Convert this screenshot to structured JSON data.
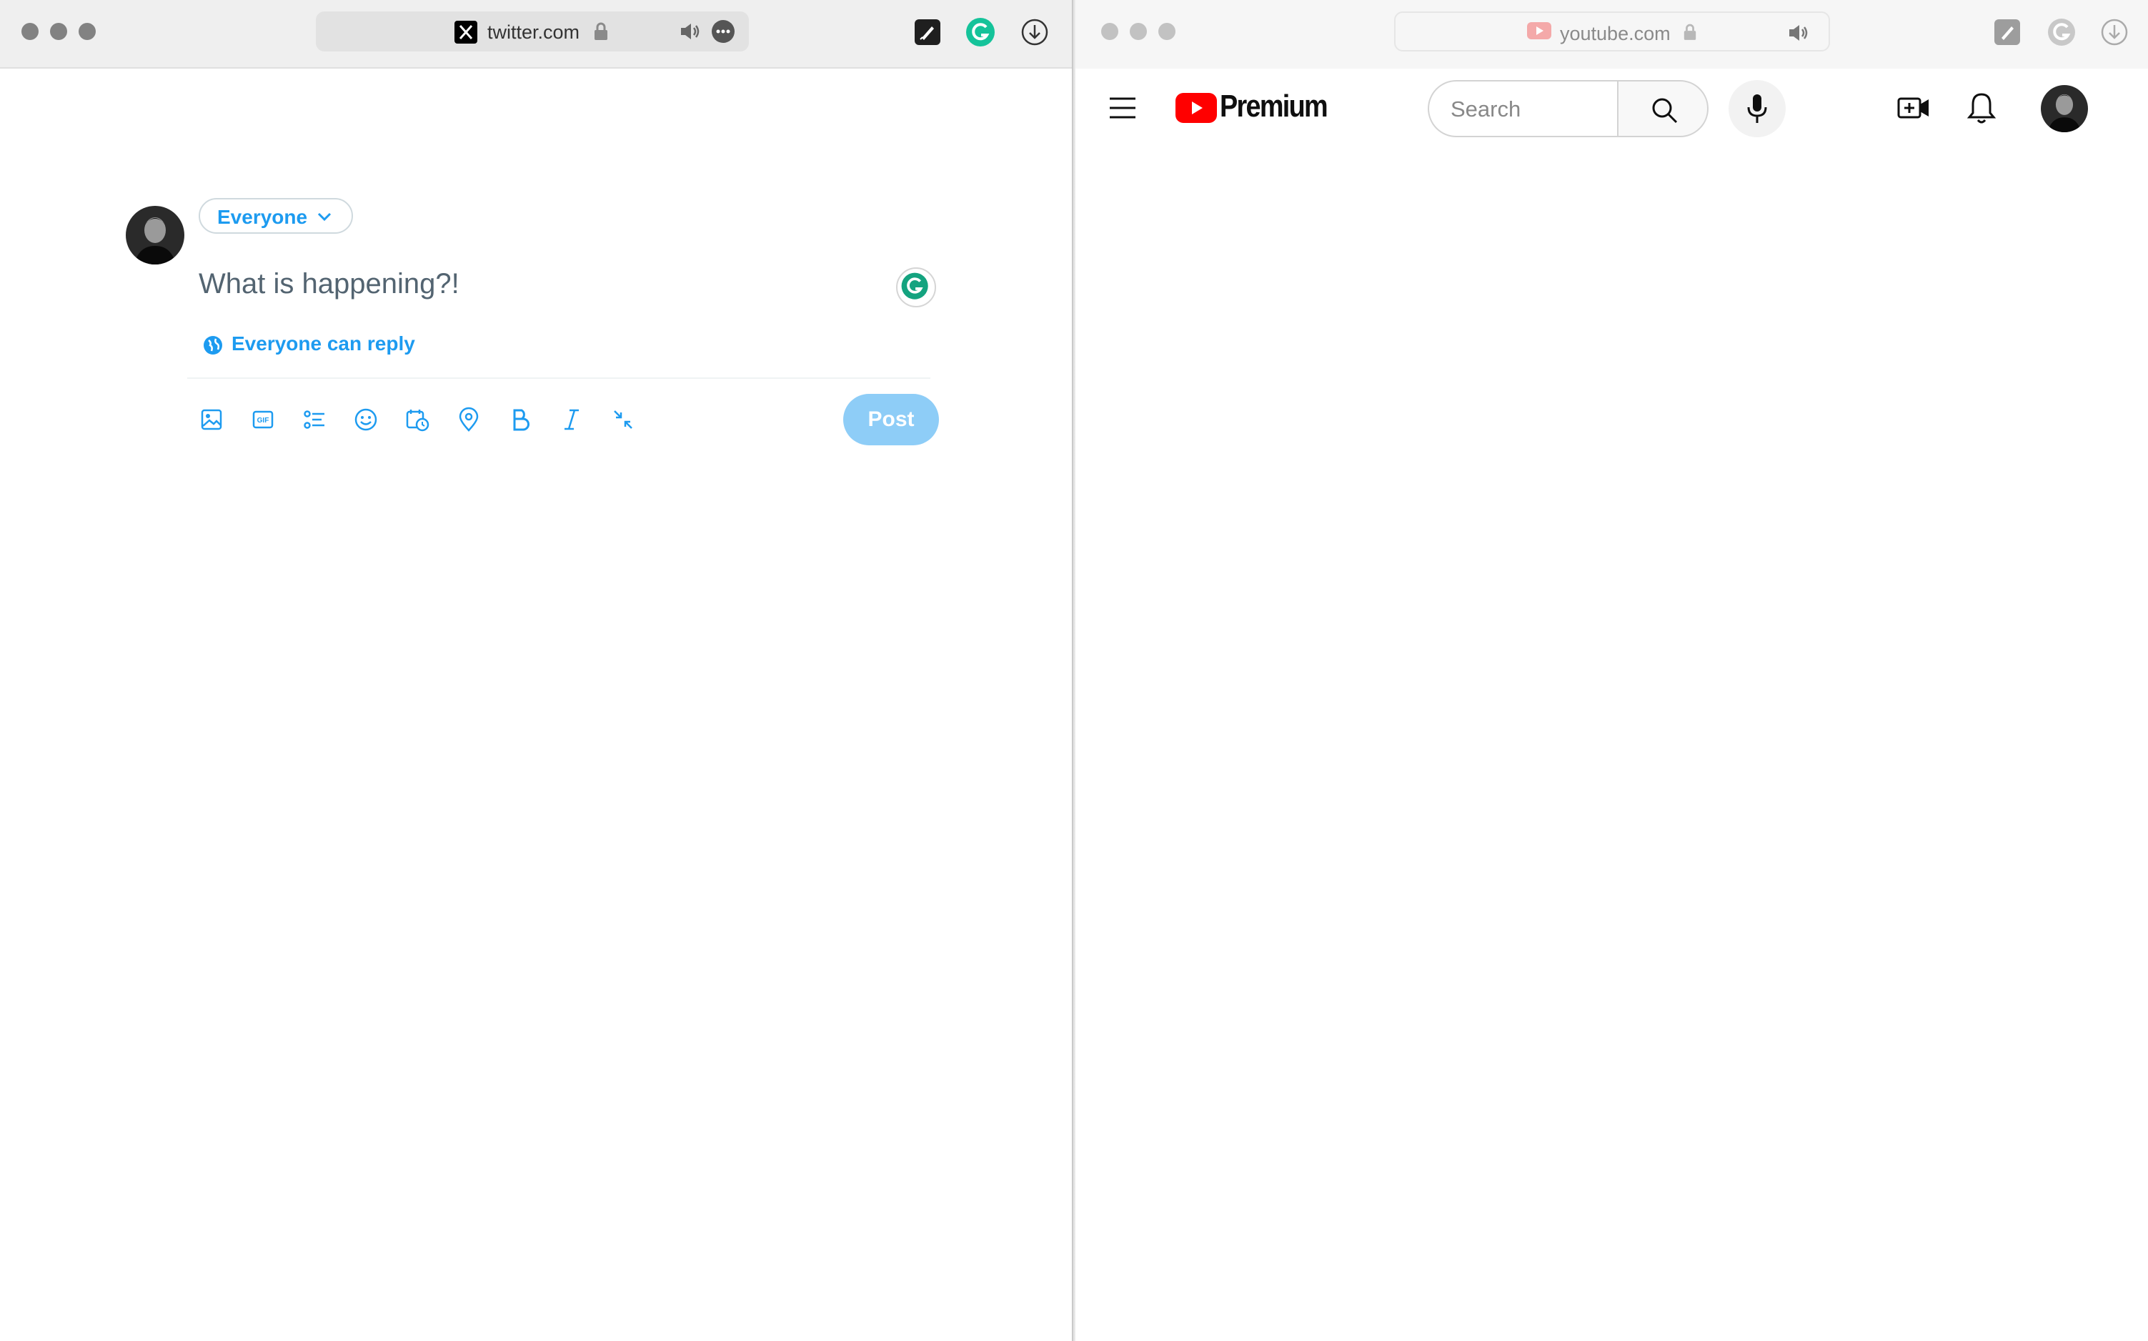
{
  "left_window": {
    "address_bar": {
      "url": "twitter.com"
    },
    "compose": {
      "audience_label": "Everyone",
      "placeholder": "What is happening?!",
      "reply_setting": "Everyone can reply",
      "post_label": "Post",
      "toolbar_icons": [
        "image-icon",
        "gif-icon",
        "poll-icon",
        "emoji-icon",
        "schedule-icon",
        "location-icon",
        "bold-icon",
        "italic-icon",
        "collapse-icon"
      ]
    }
  },
  "right_window": {
    "address_bar": {
      "url": "youtube.com"
    },
    "header": {
      "logo_text": "Premium",
      "search_placeholder": "Search"
    }
  },
  "colors": {
    "twitter_blue": "#1d9bf0",
    "post_button_disabled": "#8ecdf7",
    "youtube_red": "#ff0000",
    "grammarly_green": "#15c39a"
  }
}
